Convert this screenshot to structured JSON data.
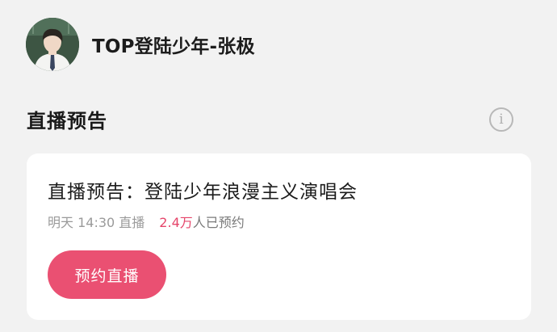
{
  "account": {
    "name": "TOP登陆少年-张极"
  },
  "section": {
    "title": "直播预告",
    "info_icon": "info-circle-icon",
    "info_glyph": "i"
  },
  "card": {
    "title": "直播预告：登陆少年浪漫主义演唱会",
    "schedule": "明天 14:30 直播",
    "reservation_count": "2.4万",
    "reservation_suffix": "人已预约",
    "button_label": "预约直播"
  },
  "colors": {
    "accent": "#ea5072",
    "count_highlight": "#e5456a",
    "background": "#f2f2f2",
    "card": "#ffffff"
  }
}
